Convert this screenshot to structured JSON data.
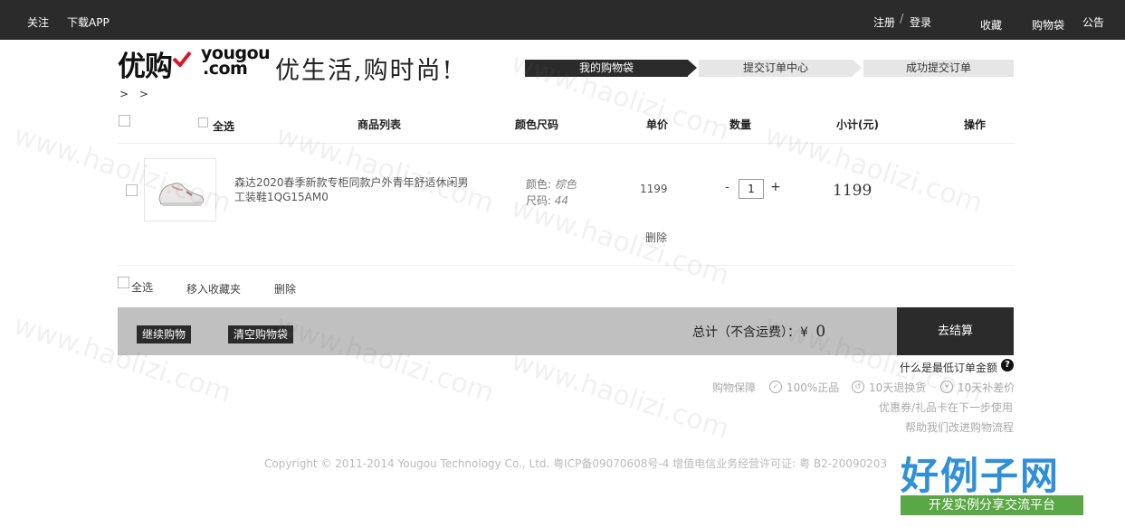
{
  "topbar": {
    "follow": "关注",
    "download_app": "下载APP",
    "register": "注册",
    "separator": "/",
    "login": "登录",
    "favorites": "收藏",
    "cart": "购物袋",
    "notice": "公告"
  },
  "logo": {
    "cn": "优购",
    "en_line1": "yougou",
    "en_line2": ".com",
    "slogan": "优生活,购时尚!"
  },
  "steps": [
    "我的购物袋",
    "提交订单中心",
    "成功提交订单"
  ],
  "breadcrumb": "> >",
  "table": {
    "select_all": "全选",
    "headers": {
      "goods": "商品列表",
      "color_size": "颜色尺码",
      "unit_price": "单价",
      "quantity": "数量",
      "subtotal": "小计(元)",
      "action": "操作"
    }
  },
  "item": {
    "name": "森达2020春季新款专柜同款户外青年舒适休闲男工装鞋1QG15AM0",
    "color_label": "颜色:",
    "color_value": "棕色",
    "size_label": "尺码:",
    "size_value": "44",
    "price": "1199",
    "qty_minus": "-",
    "quantity": "1",
    "qty_plus": "+",
    "subtotal": "1199",
    "delete": "删除"
  },
  "tools": {
    "select_all": "全选",
    "move_to_favorites": "移入收藏夹",
    "delete": "删除"
  },
  "totals": {
    "continue_shopping": "继续购物",
    "clear_cart": "清空购物袋",
    "total_label": "总计（不含运费）：¥",
    "total_value": "0",
    "checkout": "去结算"
  },
  "info": {
    "min_order": "什么是最低订单金额",
    "help_icon": "?",
    "guarantee_label": "购物保障",
    "g1": "100%正品",
    "g2": "10天退换货",
    "g3": "10天补差价",
    "coupon_note": "优惠券/礼品卡在下一步使用",
    "feedback": "帮助我们改进购物流程"
  },
  "footer": {
    "copyright": "Copyright © 2011-2014 Yougou Technology Co., Ltd. 粤ICP备09070608号-4 增值电信业务经营许可证: 粤 B2-20090203"
  },
  "watermark": {
    "text": "www.haolizi.com",
    "brand": "好例子网",
    "brand_sub": "开发实例分享交流平台"
  },
  "colors": {
    "dark": "#2b2b2b",
    "step_inactive": "#e6e6e6",
    "total_bar": "#c0c0c0",
    "logo_check": "#d7182a"
  }
}
